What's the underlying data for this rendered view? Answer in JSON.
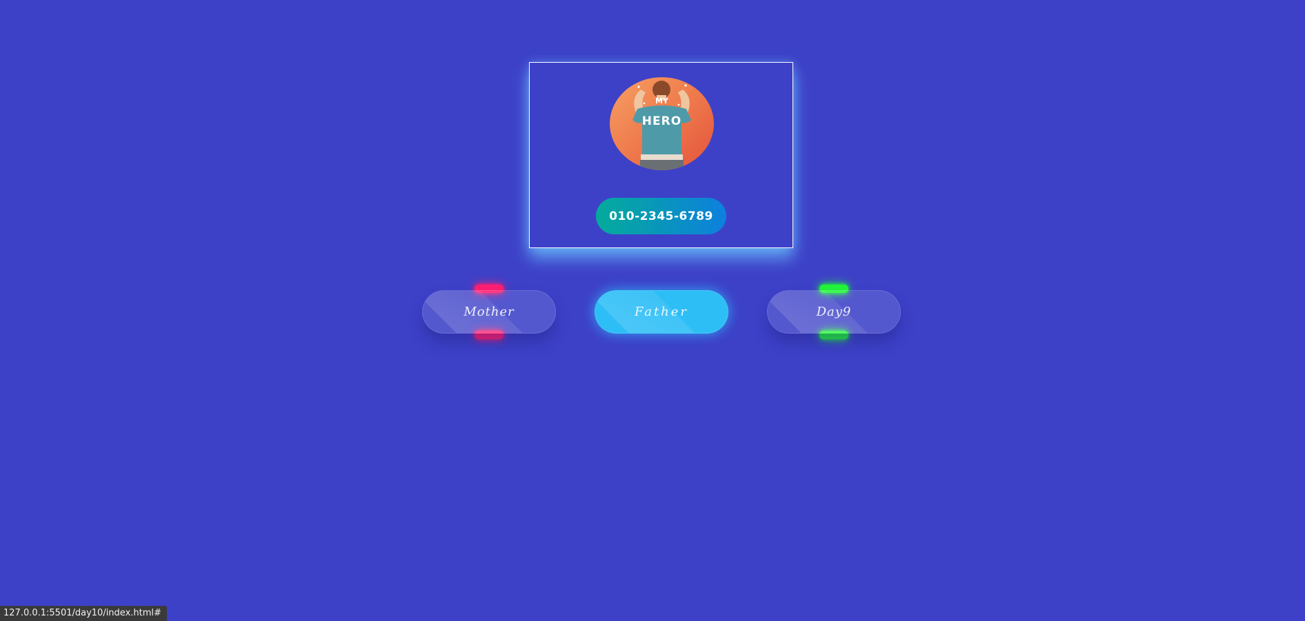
{
  "card": {
    "avatar_alt": "MY HERO",
    "avatar_text_top": "MY",
    "avatar_text_main": "HERO",
    "phone_label": "010-2345-6789"
  },
  "buttons": [
    {
      "label": "Mother",
      "glow_color": "#ff1f71",
      "active": false
    },
    {
      "label": "Father",
      "glow_color": "#2ebef6",
      "active": true
    },
    {
      "label": "Day9",
      "glow_color": "#22f53a",
      "active": false
    }
  ],
  "status_bar": {
    "url": "127.0.0.1:5501/day10/index.html#"
  },
  "colors": {
    "background": "#3d41c8",
    "phone_gradient_start": "#04ab9b",
    "phone_gradient_end": "#0d80dd",
    "card_glow": "#6ec8ff"
  }
}
